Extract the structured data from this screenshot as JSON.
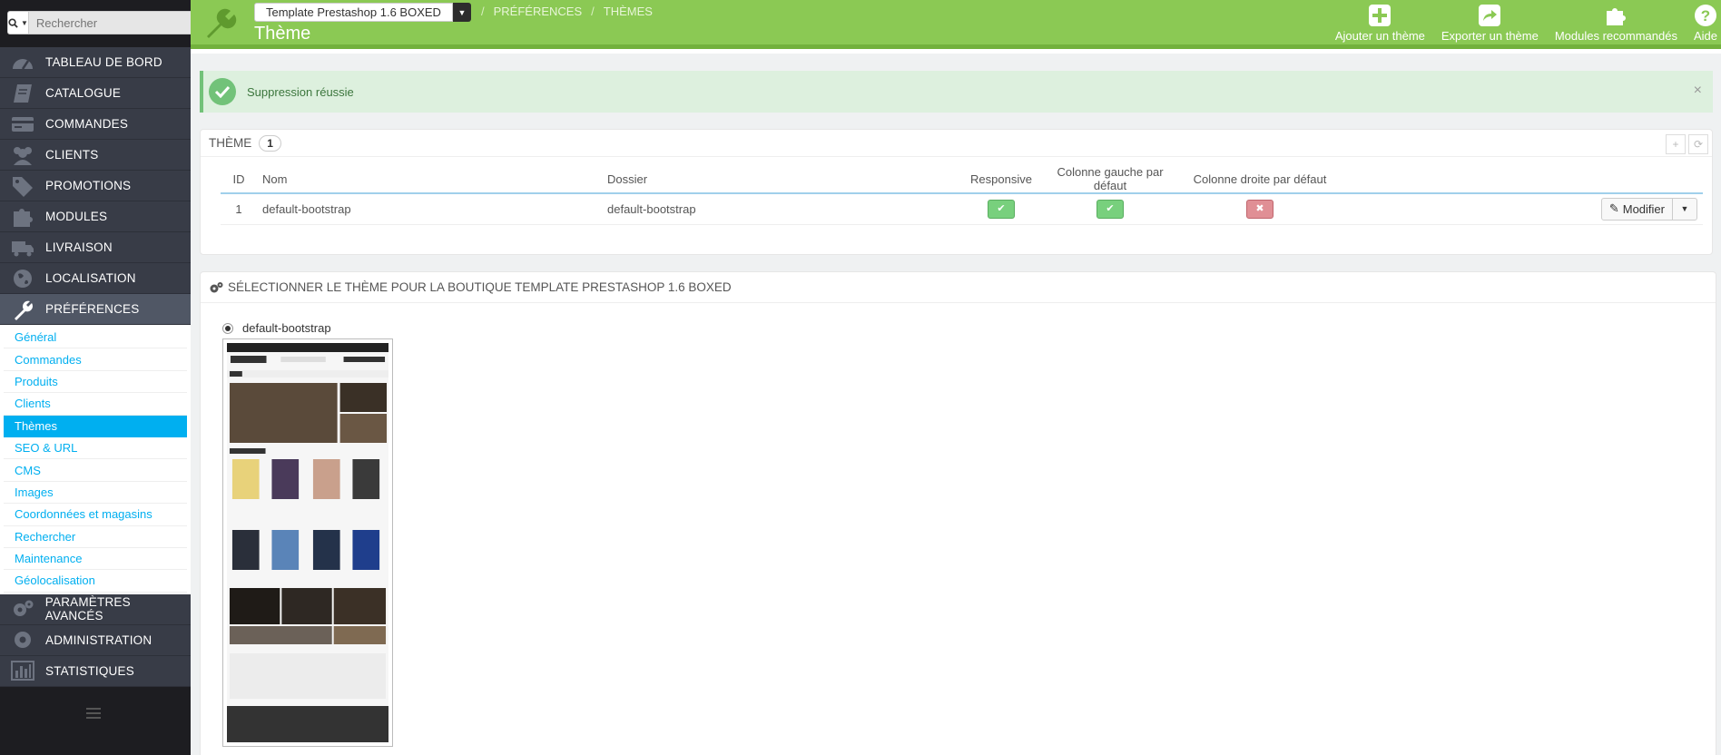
{
  "search": {
    "placeholder": "Rechercher"
  },
  "header": {
    "shop_selector": "Template Prestashop 1.6 BOXED",
    "breadcrumb": [
      "PRÉFÉRENCES",
      "THÈMES"
    ],
    "title": "Thème",
    "toolbar": [
      {
        "label": "Ajouter un thème",
        "icon": "plus-icon"
      },
      {
        "label": "Exporter un thème",
        "icon": "export-icon"
      },
      {
        "label": "Modules recommandés",
        "icon": "puzzle-icon"
      },
      {
        "label": "Aide",
        "icon": "help-icon"
      }
    ]
  },
  "sidebar": {
    "menu": [
      {
        "label": "TABLEAU DE BORD",
        "icon": "dashboard-icon"
      },
      {
        "label": "CATALOGUE",
        "icon": "book-icon"
      },
      {
        "label": "COMMANDES",
        "icon": "credit-card-icon"
      },
      {
        "label": "CLIENTS",
        "icon": "users-icon"
      },
      {
        "label": "PROMOTIONS",
        "icon": "tag-icon"
      },
      {
        "label": "MODULES",
        "icon": "puzzle-icon"
      },
      {
        "label": "LIVRAISON",
        "icon": "truck-icon"
      },
      {
        "label": "LOCALISATION",
        "icon": "globe-icon"
      },
      {
        "label": "PRÉFÉRENCES",
        "icon": "wrench-icon"
      }
    ],
    "submenu": [
      "Général",
      "Commandes",
      "Produits",
      "Clients",
      "Thèmes",
      "SEO & URL",
      "CMS",
      "Images",
      "Coordonnées et magasins",
      "Rechercher",
      "Maintenance",
      "Géolocalisation"
    ],
    "menu_after": [
      {
        "label": "PARAMÈTRES AVANCÉS",
        "icon": "cogs-icon"
      },
      {
        "label": "ADMINISTRATION",
        "icon": "gear-icon"
      },
      {
        "label": "STATISTIQUES",
        "icon": "bar-chart-icon"
      }
    ]
  },
  "alert": {
    "message": "Suppression réussie",
    "close": "×"
  },
  "theme_panel": {
    "title": "THÈME",
    "count": "1",
    "columns": [
      "ID",
      "Nom",
      "Dossier",
      "Responsive",
      "Colonne gauche par défaut",
      "Colonne droite par défaut"
    ],
    "rows": [
      {
        "id": "1",
        "name": "default-bootstrap",
        "folder": "default-bootstrap",
        "responsive": true,
        "left_col": true,
        "right_col": false
      }
    ],
    "edit_button": "Modifier"
  },
  "select_panel": {
    "title": "SÉLECTIONNER LE THÈME POUR LA BOUTIQUE TEMPLATE PRESTASHOP 1.6 BOXED",
    "theme_option": "default-bootstrap"
  },
  "colors": {
    "header_green": "#8bc954",
    "accent_blue": "#00aff0",
    "sidebar_bg": "#383c47"
  }
}
